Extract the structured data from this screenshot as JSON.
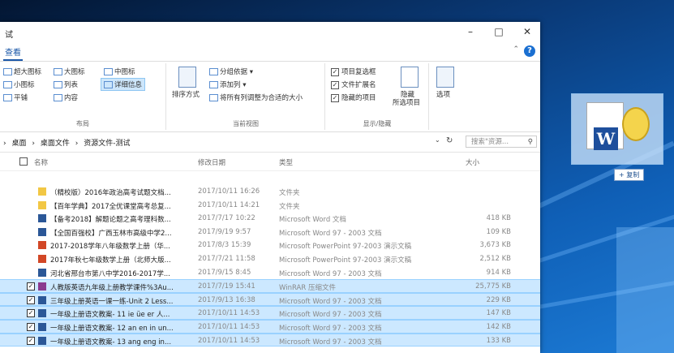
{
  "window": {
    "title": "试"
  },
  "tabs": {
    "active": "查看"
  },
  "ribbon": {
    "layout": {
      "items": [
        "超大图标",
        "大图标",
        "中图标",
        "小图标",
        "列表",
        "详细信息",
        "平铺",
        "内容"
      ],
      "label": "布局"
    },
    "current_view": {
      "sort_label": "排序方式",
      "group_by": "分组依据",
      "add_column": "添加列",
      "fit_columns": "将所有列调整为合适的大小",
      "label": "当前视图"
    },
    "show_hide": {
      "item_checkbox": "项目复选框",
      "file_ext": "文件扩展名",
      "hidden_items": "隐藏的项目",
      "hide_btn": "隐藏",
      "hide_sel": "所选项目",
      "label": "显示/隐藏"
    },
    "options_label": "选项"
  },
  "address": {
    "crumbs": [
      "桌面",
      "桌面文件",
      "资源文件-测试"
    ],
    "search_placeholder": "搜索\"资源..."
  },
  "columns": {
    "name": "名称",
    "date": "修改日期",
    "type": "类型",
    "size": "大小"
  },
  "files": [
    {
      "name": "（精校版）2016年政治高考试题文档...",
      "date": "2017/10/11 16:26",
      "type": "文件夹",
      "size": "",
      "icon": "folder-icon",
      "selected": false
    },
    {
      "name": "【百年学典】2017全优课堂高考总复...",
      "date": "2017/10/11 14:21",
      "type": "文件夹",
      "size": "",
      "icon": "folder-icon",
      "selected": false
    },
    {
      "name": "【备考2018】解题论题之高考理科数...",
      "date": "2017/7/17 10:22",
      "type": "Microsoft Word 文档",
      "size": "418 KB",
      "icon": "word-doc-icon",
      "selected": false
    },
    {
      "name": "【全国百强校】广西玉林市高级中学2...",
      "date": "2017/9/19 9:57",
      "type": "Microsoft Word 97 - 2003 文档",
      "size": "109 KB",
      "icon": "word-doc-icon",
      "selected": false
    },
    {
      "name": "2017-2018学年八年级数学上册（华...",
      "date": "2017/8/3 15:39",
      "type": "Microsoft PowerPoint 97-2003 演示文稿",
      "size": "3,673 KB",
      "icon": "powerpoint-icon",
      "selected": false
    },
    {
      "name": "2017年秋七年级数学上册（北师大版...",
      "date": "2017/7/21 11:58",
      "type": "Microsoft PowerPoint 97-2003 演示文稿",
      "size": "2,512 KB",
      "icon": "powerpoint-icon",
      "selected": false
    },
    {
      "name": "河北省邢台市第八中学2016-2017学...",
      "date": "2017/9/15 8:45",
      "type": "Microsoft Word 97 - 2003 文档",
      "size": "914 KB",
      "icon": "word-doc-icon",
      "selected": false
    },
    {
      "name": "人教版英语九年级上册教学课件%3Au...",
      "date": "2017/7/19 15:41",
      "type": "WinRAR 压缩文件",
      "size": "25,775 KB",
      "icon": "winrar-icon",
      "selected": true
    },
    {
      "name": "三年级上册英语一课一练-Unit 2 Less...",
      "date": "2017/9/13 16:38",
      "type": "Microsoft Word 97 - 2003 文档",
      "size": "229 KB",
      "icon": "word-doc-icon",
      "selected": true
    },
    {
      "name": "一年级上册语文教案- 11 ie üe er 人...",
      "date": "2017/10/11 14:53",
      "type": "Microsoft Word 97 - 2003 文档",
      "size": "147 KB",
      "icon": "word-doc-icon",
      "selected": true
    },
    {
      "name": "一年级上册语文教案- 12 an en in un...",
      "date": "2017/10/11 14:53",
      "type": "Microsoft Word 97 - 2003 文档",
      "size": "142 KB",
      "icon": "word-doc-icon",
      "selected": true
    },
    {
      "name": "一年级上册语文教案- 13 ang eng in...",
      "date": "2017/10/11 14:53",
      "type": "Microsoft Word 97 - 2003 文档",
      "size": "133 KB",
      "icon": "word-doc-icon",
      "selected": true
    }
  ],
  "drag": {
    "copy_label": "+ 复制"
  }
}
